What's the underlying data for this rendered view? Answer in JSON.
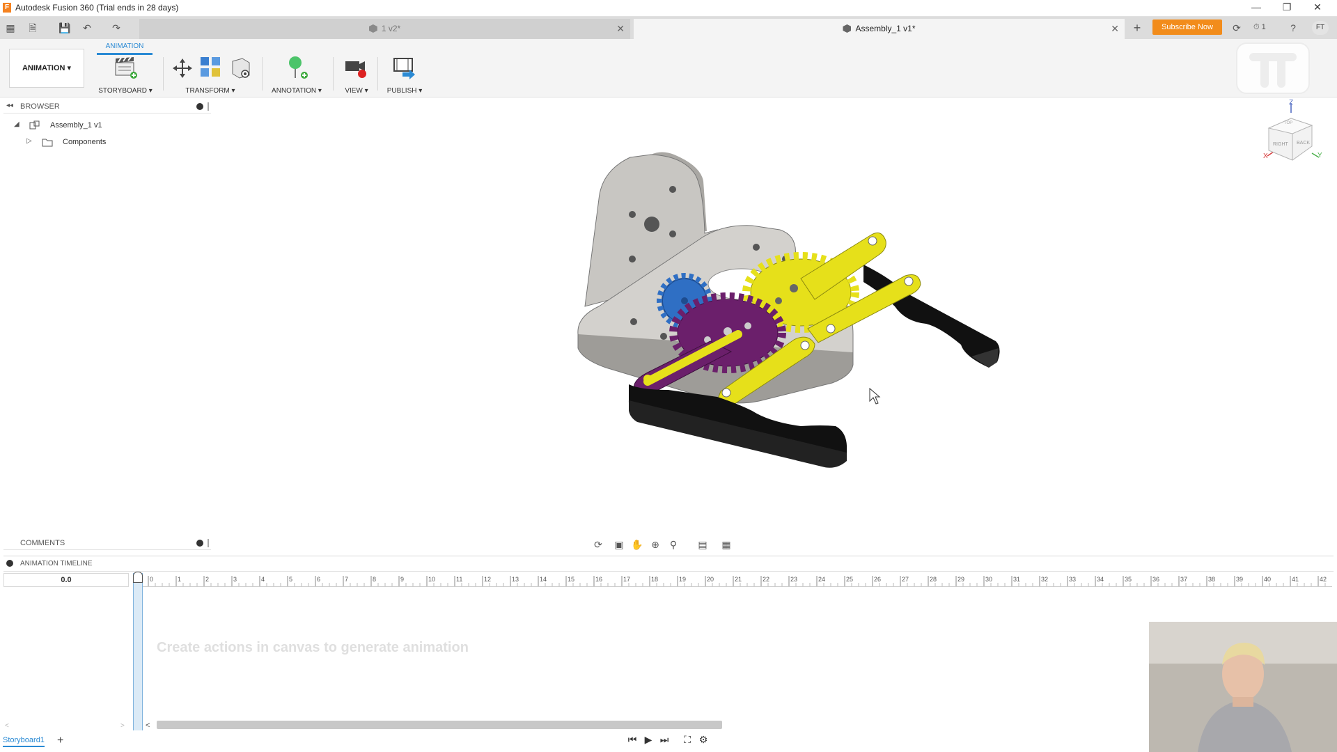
{
  "window": {
    "title": "Autodesk Fusion 360 (Trial ends in 28 days)",
    "app_logo_letter": "F"
  },
  "tabs": [
    {
      "label": "1 v2*",
      "active": false
    },
    {
      "label": "Assembly_1 v1*",
      "active": true
    }
  ],
  "header_actions": {
    "subscribe_label": "Subscribe Now",
    "notification_count": "1",
    "user_initials": "FT"
  },
  "toolbar": {
    "workspace_label": "ANIMATION",
    "active_tab": "ANIMATION",
    "groups": [
      {
        "label": "STORYBOARD"
      },
      {
        "label": "TRANSFORM"
      },
      {
        "label": "ANNOTATION"
      },
      {
        "label": "VIEW"
      },
      {
        "label": "PUBLISH"
      }
    ]
  },
  "browser": {
    "title": "BROWSER",
    "root": "Assembly_1 v1",
    "children": [
      "Components"
    ]
  },
  "viewcube": {
    "axis_z": "Z",
    "axis_x": "X",
    "axis_y": "Y",
    "face_right": "RIGHT",
    "face_back": "BACK",
    "face_top": "TOP"
  },
  "comments": {
    "title": "COMMENTS"
  },
  "timeline": {
    "title": "ANIMATION TIMELINE",
    "current_time": "0.0",
    "ticks": [
      "0",
      "1",
      "2",
      "3",
      "4",
      "5",
      "6",
      "7",
      "8",
      "9",
      "10",
      "11",
      "12",
      "13",
      "14",
      "15",
      "16",
      "17",
      "18",
      "19",
      "20",
      "21",
      "22",
      "23",
      "24",
      "25",
      "26",
      "27",
      "28",
      "29",
      "30",
      "31",
      "32",
      "33",
      "34",
      "35",
      "36",
      "37",
      "38",
      "39",
      "40",
      "41",
      "42"
    ],
    "hint": "Create actions in canvas to generate animation",
    "storyboard_tab": "Storyboard1"
  },
  "colors": {
    "accent": "#2a8ad4",
    "subscribe": "#f28c1b",
    "gear_blue": "#2f6fc4",
    "gear_purple": "#6b1f6b",
    "gear_yellow": "#e6e01a",
    "jaw_black": "#111111",
    "base_gray": "#c8c6c2"
  }
}
